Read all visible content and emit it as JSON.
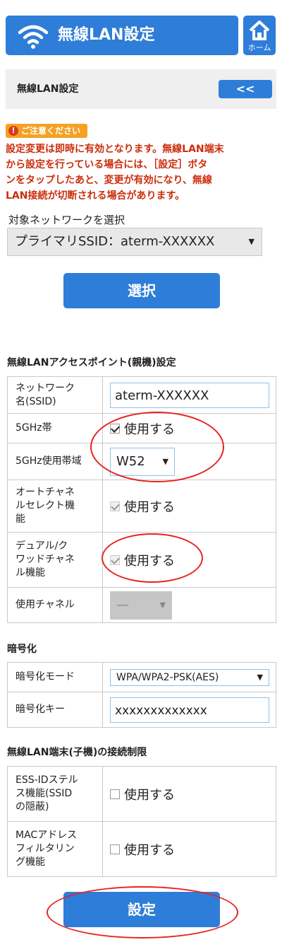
{
  "header": {
    "title": "無線LAN設定",
    "home_label": "ホーム"
  },
  "subheader": {
    "label": "無線LAN設定",
    "back_label": "<<"
  },
  "notice": {
    "badge": "ご注意ください",
    "text": "設定変更は即時に有効となります。無線LAN端末\nから設定を行っている場合には、［設定］ボタ\nンをタップしたあと、変更が有効になり、無線\nLAN接続が切断される場合があります。"
  },
  "network": {
    "label": "対象ネットワークを選択",
    "selected": "プライマリSSID：aterm-XXXXXX",
    "select_button": "選択"
  },
  "ap_section": {
    "title": "無線LANアクセスポイント(親機)設定",
    "rows": {
      "ssid": {
        "label": "ネットワーク\n名(SSID)",
        "value": "aterm-XXXXXX"
      },
      "band5g": {
        "label": "5GHz帯",
        "checkbox_label": "使用する",
        "checked": true
      },
      "band5g_area": {
        "label": "5GHz使用帯域",
        "selected": "W52"
      },
      "auto_channel": {
        "label": "オートチャネ\nルセレクト機\n能",
        "checkbox_label": "使用する",
        "checked": true
      },
      "dual_quad": {
        "label": "デュアル/ク\nワッドチャネ\nル機能",
        "checkbox_label": "使用する",
        "checked": true
      },
      "channel": {
        "label": "使用チャネル",
        "selected": "—"
      }
    }
  },
  "encryption_section": {
    "title": "暗号化",
    "rows": {
      "mode": {
        "label": "暗号化モード",
        "selected": "WPA/WPA2-PSK(AES)"
      },
      "key": {
        "label": "暗号化キー",
        "value": "xxxxxxxxxxxxx"
      }
    }
  },
  "restriction_section": {
    "title": "無線LAN端末(子機)の接続制限",
    "rows": {
      "stealth": {
        "label": "ESS-IDステル\nス機能(SSID\nの隠蔽)",
        "checkbox_label": "使用する",
        "checked": false
      },
      "mac_filter": {
        "label": "MACアドレス\nフィルタリン\nグ機能",
        "checkbox_label": "使用する",
        "checked": false
      }
    }
  },
  "save_button": "設定",
  "colors": {
    "accent": "#2e7dd8",
    "notice_text": "#cc2e0d",
    "notice_badge": "#f4a224",
    "annotation": "#e8231e"
  }
}
